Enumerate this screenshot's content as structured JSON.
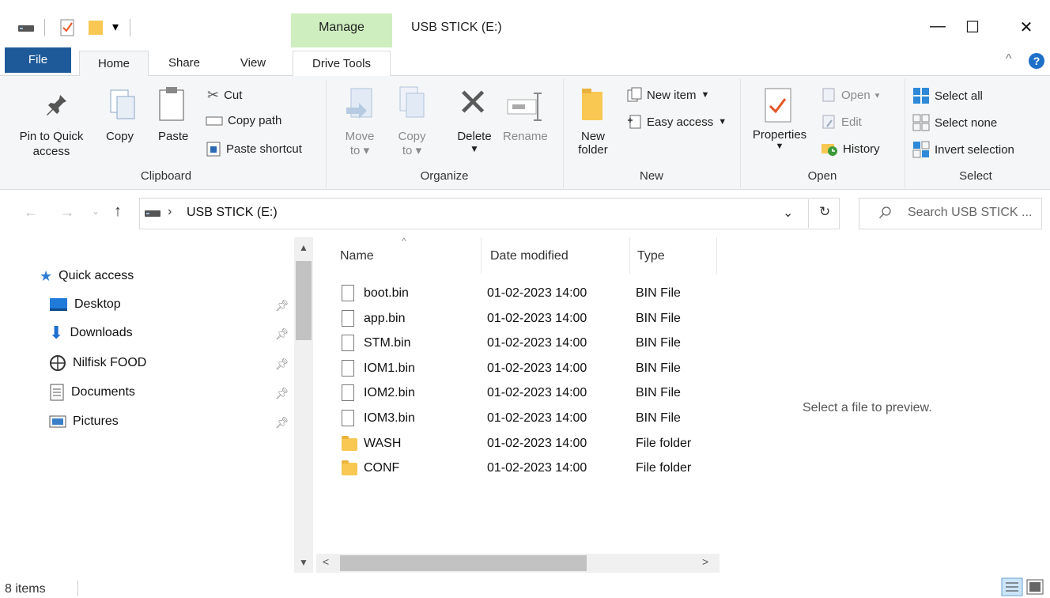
{
  "window": {
    "title": "USB STICK (E:)",
    "context_tab": "Manage",
    "minimize": "—",
    "maximize": "☐",
    "close": "✕"
  },
  "tabs": {
    "file": "File",
    "home": "Home",
    "share": "Share",
    "view": "View",
    "drive_tools": "Drive Tools"
  },
  "ribbon": {
    "clipboard": {
      "pin": "Pin to Quick",
      "pin2": "access",
      "copy": "Copy",
      "paste": "Paste",
      "cut": "Cut",
      "copy_path": "Copy path",
      "paste_shortcut": "Paste shortcut",
      "label": "Clipboard"
    },
    "organize": {
      "move": "Move",
      "move2": "to",
      "copy": "Copy",
      "copy2": "to",
      "delete": "Delete",
      "rename": "Rename",
      "label": "Organize"
    },
    "new": {
      "new_folder": "New",
      "new_folder2": "folder",
      "new_item": "New item",
      "easy_access": "Easy access",
      "label": "New"
    },
    "open": {
      "properties": "Properties",
      "open": "Open",
      "edit": "Edit",
      "history": "History",
      "label": "Open"
    },
    "select": {
      "select_all": "Select all",
      "select_none": "Select none",
      "invert": "Invert selection",
      "label": "Select"
    }
  },
  "address": {
    "path": "USB STICK (E:)",
    "separator": "›",
    "search_placeholder": "Search USB STICK ..."
  },
  "nav": {
    "quick_access": "Quick access",
    "items": [
      {
        "label": "Desktop"
      },
      {
        "label": "Downloads"
      },
      {
        "label": "Nilfisk FOOD"
      },
      {
        "label": "Documents"
      },
      {
        "label": "Pictures"
      }
    ]
  },
  "columns": {
    "name": "Name",
    "date": "Date modified",
    "type": "Type"
  },
  "files": [
    {
      "name": "boot.bin",
      "date": "01-02-2023 14:00",
      "type": "BIN File",
      "kind": "file"
    },
    {
      "name": "app.bin",
      "date": "01-02-2023 14:00",
      "type": "BIN File",
      "kind": "file"
    },
    {
      "name": "STM.bin",
      "date": "01-02-2023 14:00",
      "type": "BIN File",
      "kind": "file"
    },
    {
      "name": "IOM1.bin",
      "date": "01-02-2023 14:00",
      "type": "BIN File",
      "kind": "file"
    },
    {
      "name": "IOM2.bin",
      "date": "01-02-2023 14:00",
      "type": "BIN File",
      "kind": "file"
    },
    {
      "name": "IOM3.bin",
      "date": "01-02-2023 14:00",
      "type": "BIN File",
      "kind": "file"
    },
    {
      "name": "WASH",
      "date": "01-02-2023 14:00",
      "type": "File folder",
      "kind": "folder"
    },
    {
      "name": "CONF",
      "date": "01-02-2023 14:00",
      "type": "File folder",
      "kind": "folder"
    }
  ],
  "preview": "Select a file to preview.",
  "status": {
    "items": "8 items"
  }
}
